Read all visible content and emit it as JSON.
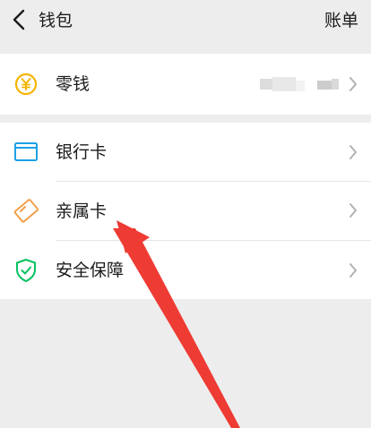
{
  "header": {
    "back_icon": "chevron-left-icon",
    "title": "钱包",
    "right_action": "账单"
  },
  "wallet": {
    "label": "零钱",
    "icon": "yuan-coin-icon",
    "balance_masked": "",
    "icon_color": "#f5b400"
  },
  "menu": [
    {
      "label": "银行卡",
      "icon": "bank-card-icon",
      "icon_color": "#1aa1e6"
    },
    {
      "label": "亲属卡",
      "icon": "family-card-icon",
      "icon_color": "#f0a04b"
    },
    {
      "label": "安全保障",
      "icon": "shield-check-icon",
      "icon_color": "#07c160"
    }
  ],
  "annotation": {
    "type": "red-arrow",
    "color": "#ee3b34"
  }
}
